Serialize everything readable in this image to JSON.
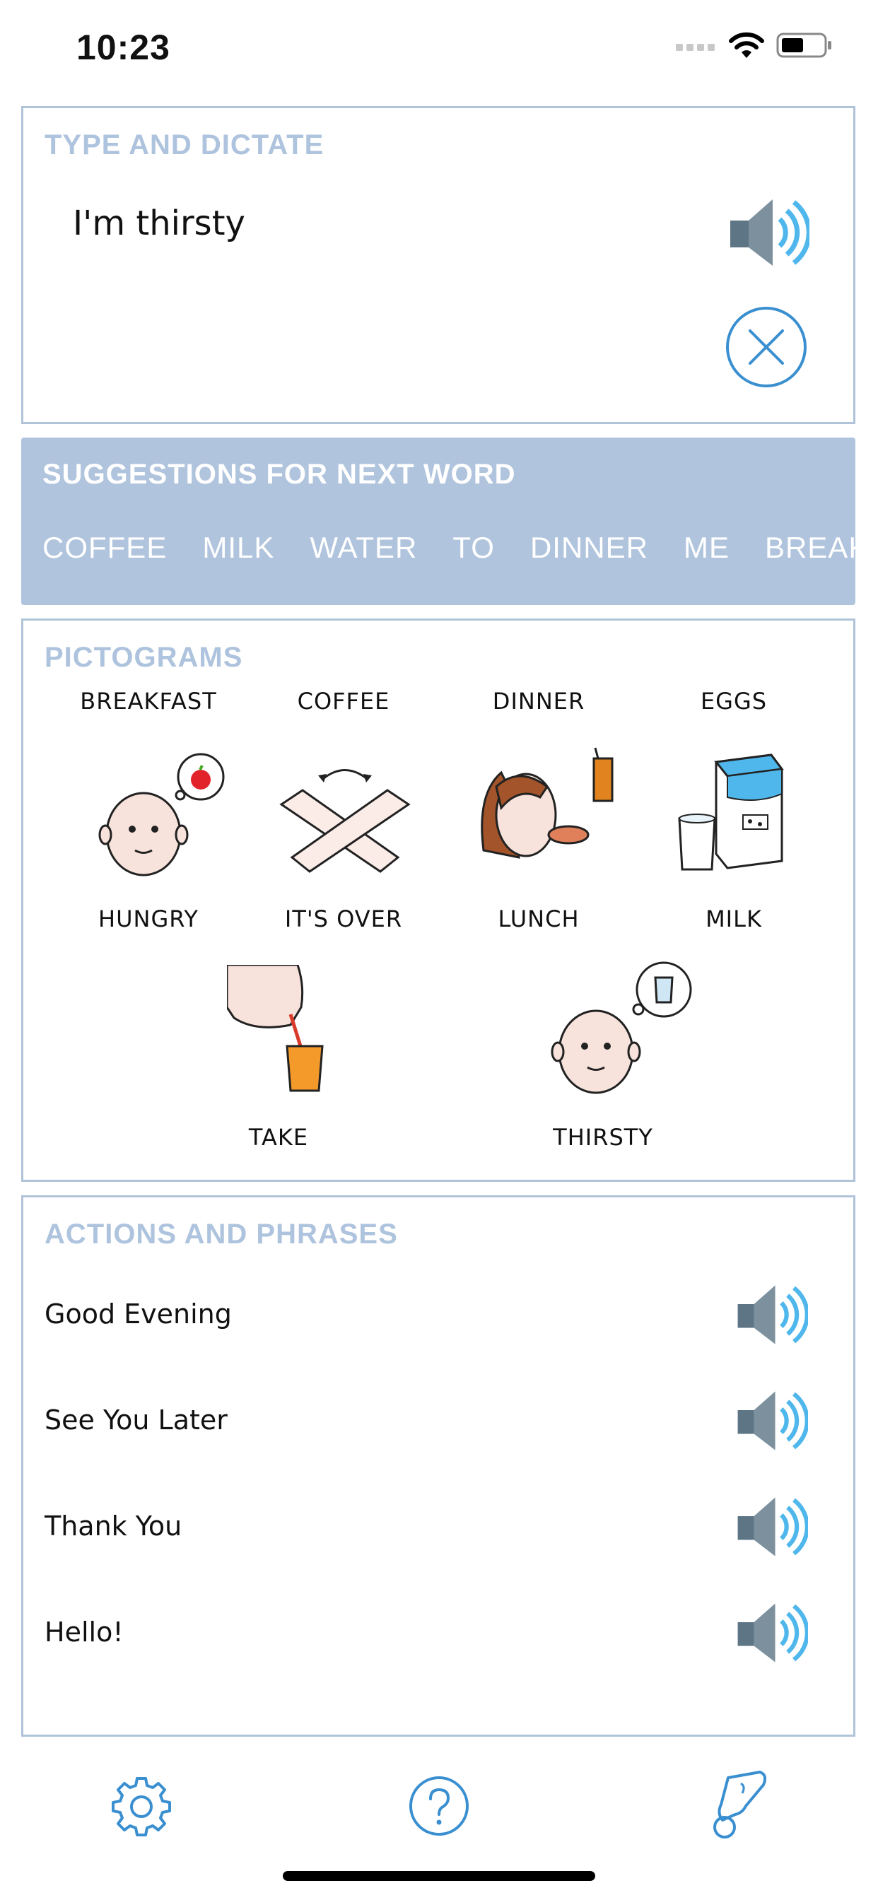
{
  "status_bar": {
    "time": "10:23",
    "icons": [
      "cellular-signal-icon",
      "wifi-icon",
      "battery-icon"
    ]
  },
  "dictate": {
    "title": "TYPE AND DICTATE",
    "text": "I'm thirsty",
    "speak_icon": "speaker-icon",
    "clear_icon": "close-circle-icon"
  },
  "suggestions": {
    "title": "SUGGESTIONS FOR NEXT WORD",
    "words": [
      "COFFEE",
      "MILK",
      "WATER",
      "TO",
      "DINNER",
      "ME",
      "BREAKF."
    ]
  },
  "pictograms": {
    "title": "PICTOGRAMS",
    "items": [
      {
        "label": "BREAKFAST",
        "icon": "breakfast-icon"
      },
      {
        "label": "COFFEE",
        "icon": "coffee-icon"
      },
      {
        "label": "DINNER",
        "icon": "dinner-icon"
      },
      {
        "label": "EGGS",
        "icon": "eggs-icon"
      },
      {
        "label": "HUNGRY",
        "icon": "hungry-face-icon"
      },
      {
        "label": "IT'S OVER",
        "icon": "crossed-arms-icon"
      },
      {
        "label": "LUNCH",
        "icon": "eating-person-icon"
      },
      {
        "label": "MILK",
        "icon": "milk-carton-icon"
      },
      {
        "label": "TAKE",
        "icon": "drinking-straw-icon"
      },
      {
        "label": "THIRSTY",
        "icon": "thirsty-face-icon"
      }
    ]
  },
  "phrases": {
    "title": "ACTIONS AND PHRASES",
    "items": [
      {
        "label": "Good Evening"
      },
      {
        "label": "See You Later"
      },
      {
        "label": "Thank You"
      },
      {
        "label": "Hello!"
      }
    ]
  },
  "tab_bar": {
    "icons": [
      "settings-gear-icon",
      "help-question-icon",
      "quick-phrase-icon"
    ]
  },
  "colors": {
    "accent_blue": "#3a8fd0",
    "panel_border": "#b0c3d9",
    "title_blue": "#aec3dd",
    "suggest_bg": "#b0c4dd",
    "speaker_gray": "#627988",
    "speaker_wave": "#4fb7ec"
  }
}
